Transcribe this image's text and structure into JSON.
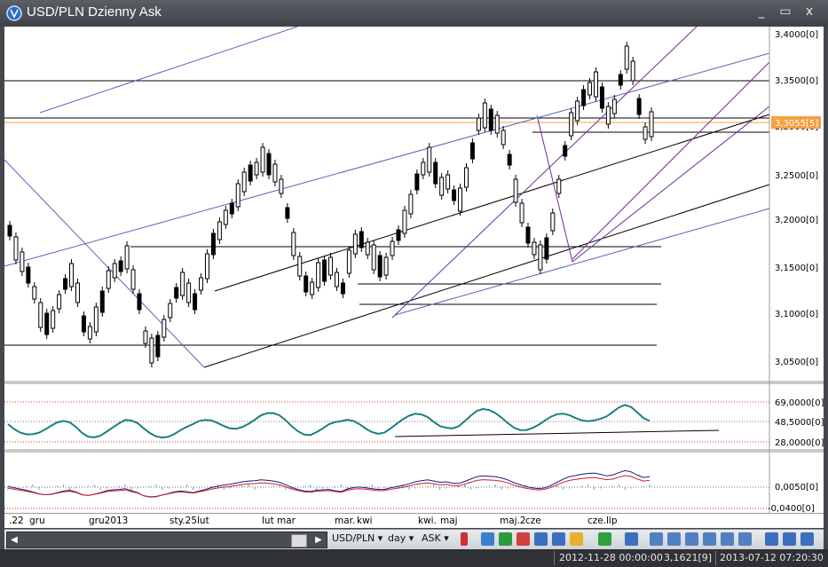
{
  "window": {
    "title": "USD/PLN Dzienny Ask",
    "minimize": "_",
    "maximize": "▭",
    "close": "x"
  },
  "price_axis": {
    "ticks": [
      "3,4000[0]",
      "3,3500[0]",
      "3,3000[0]",
      "3,2500[0]",
      "3,2000[0]",
      "3,1500[0]",
      "3,1000[0]",
      "3,0500[0]"
    ],
    "current_price_label": "3,3055[5]"
  },
  "rsi_axis": {
    "ticks": [
      "69,0000[0]",
      "48,5000[0]",
      "28,0000[0]"
    ]
  },
  "macd_axis": {
    "ticks": [
      "0,0050[0]",
      "-0,0400[0]"
    ]
  },
  "time_axis": {
    "labels": [
      ".22",
      "gru",
      "gru2013",
      "sty.25lut",
      "lut",
      "mar",
      "mar.",
      "kwi",
      "kwi.",
      "maj",
      "maj.2",
      "cze",
      "cze.",
      "lip"
    ]
  },
  "toolbar": {
    "symbol": "USD/PLN ▾",
    "period": "day ▾",
    "side": "ASK ▾",
    "icons": [
      "candle-type-icon",
      "zoom-fit-icon",
      "bar-color-icon",
      "grid-icon",
      "chart-template-icon",
      "window-icon",
      "indicators-icon",
      "cursor-icon",
      "properties-icon",
      "zoom-in-icon",
      "shift-left-icon",
      "shift-right-icon",
      "stretch-vertical-icon",
      "compress-vertical-icon",
      "zoom-out-icon",
      "cross-1-icon",
      "cross-2-icon",
      "cross-3-icon"
    ]
  },
  "status": {
    "cursor_time": "2012-11-28 00:00:00",
    "cursor_price": "3,1621[9]",
    "server_time": "2013-07-12 07:20:30"
  },
  "colors": {
    "rsi_line": "#1a7f7f",
    "price_highlight": "#f5a040",
    "trendline_purple": "#6b2c9b",
    "macd_red": "#cc2020",
    "macd_navy": "#1a1a80"
  }
}
